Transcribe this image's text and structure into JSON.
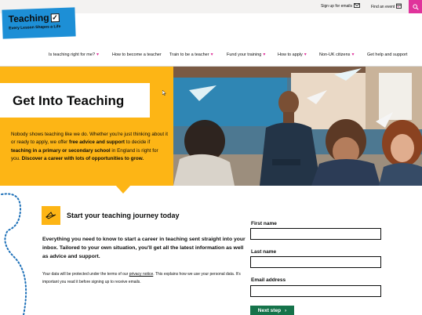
{
  "utility_bar": {
    "signup_label": "Sign up for emails",
    "events_label": "Find an event",
    "mail_icon": "envelope-icon",
    "calendar_icon": "calendar-icon",
    "search_icon": "search-icon",
    "search_color": "#e0339b"
  },
  "logo": {
    "title": "Teaching",
    "check_mark": "✓",
    "tagline": "Every Lesson Shapes a Life",
    "color": "#1d8fd6"
  },
  "nav": {
    "items": [
      {
        "label": "Is teaching right for me?",
        "has_dropdown": true
      },
      {
        "label": "How to become a teacher",
        "has_dropdown": false
      },
      {
        "label": "Train to be a teacher",
        "has_dropdown": true
      },
      {
        "label": "Fund your training",
        "has_dropdown": true
      },
      {
        "label": "How to apply",
        "has_dropdown": true
      },
      {
        "label": "Non-UK citizens",
        "has_dropdown": true
      },
      {
        "label": "Get help and support",
        "has_dropdown": false
      }
    ],
    "chevron": "▾",
    "accent": "#e0339b"
  },
  "hero": {
    "title": "Get Into Teaching",
    "text_plain_1": "Nobody shows teaching like we do. Whether you're just thinking about it or ready to apply, we offer ",
    "text_bold_1": "free advice and support",
    "text_plain_2": " to decide if ",
    "text_bold_2": "teaching in a primary or secondary school",
    "text_plain_3": " in England is right for you. ",
    "text_bold_3": "Discover a career with lots of opportunities to grow.",
    "background": "#fdb515"
  },
  "signup": {
    "title": "Start your teaching journey today",
    "icon": "paper-plane-icon",
    "intro": "Everything you need to know to start a career in teaching sent straight into your inbox. Tailored to your own situation, you'll get all the latest information as well as advice and support.",
    "privacy_before": "Your data will be protected under the terms of our ",
    "privacy_link": "privacy notice",
    "privacy_after": ". This explains how we use your personal data. It's important you read it before signing up to receive emails.",
    "first_name_label": "First name",
    "last_name_label": "Last name",
    "email_label": "Email address",
    "first_name_value": "",
    "last_name_value": "",
    "email_value": "",
    "next_label": "Next step",
    "next_arrow": "›",
    "button_color": "#15734a"
  }
}
